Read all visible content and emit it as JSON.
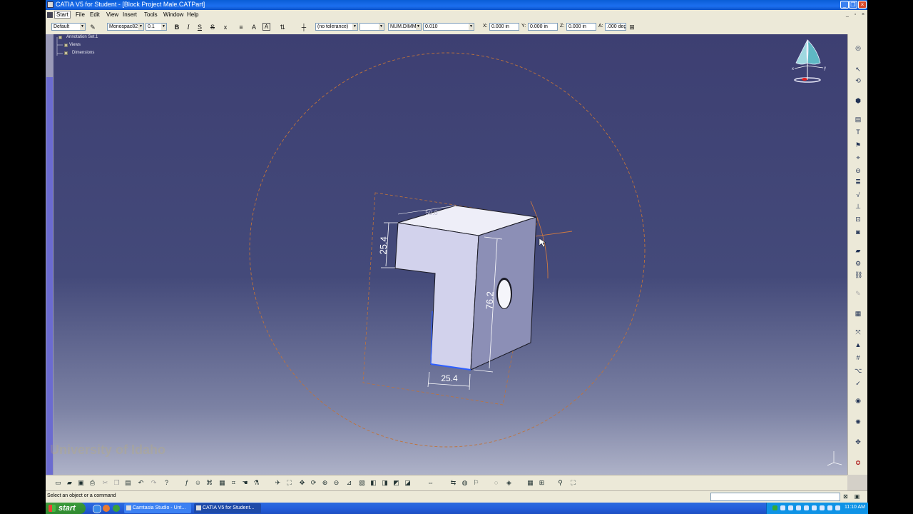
{
  "window": {
    "title": "CATIA V5 for Student - [Block Project Male.CATPart]",
    "minimize": "_",
    "restore": "❐",
    "close": "×"
  },
  "menu": {
    "items": [
      "Start",
      "File",
      "Edit",
      "View",
      "Insert",
      "Tools",
      "Window",
      "Help"
    ]
  },
  "toolbar": {
    "style_combo": "Default",
    "font_combo": "Monospac821",
    "size_combo": "0.1",
    "bold": "B",
    "italic": "I",
    "underline": "S",
    "strike": "S",
    "superscript": "x",
    "tolerance_combo": "(no tolerance)",
    "blank_combo": "",
    "dimtype_combo": "NUM.DIMM",
    "precision_combo": "0.010",
    "x_label": "X:",
    "x_value": "0.000 in",
    "y_label": "Y:",
    "y_value": "0.000 in",
    "z_label": "Z:",
    "z_value": "0.000 in",
    "a_label": "A:",
    "a_value": ".000 deg"
  },
  "tree": {
    "root": "Annotation Set.1",
    "children": [
      "Views",
      "Dimensions"
    ]
  },
  "watermark": "University of Idaho",
  "dimensions": {
    "height_left": "25.4",
    "height_front": "76.2",
    "width_bottom": "25.4",
    "hidden_top": "50.8"
  },
  "status": {
    "message": "Select an object or a command"
  },
  "taskbar": {
    "start_label": "start",
    "tasks": [
      "Camtasia Studio - Unt...",
      "CATIA V5 for Student..."
    ],
    "clock": "11:10 AM"
  },
  "compass": {
    "x_label": "x",
    "y_label": "y",
    "z_label": "z"
  },
  "colors": {
    "viewport_top": "#3d3f72",
    "viewport_bottom": "#aeb2c8",
    "part_face": "#eeeef8",
    "dashed_circle": "#c0733a",
    "selection_blue": "#2f5fff"
  }
}
